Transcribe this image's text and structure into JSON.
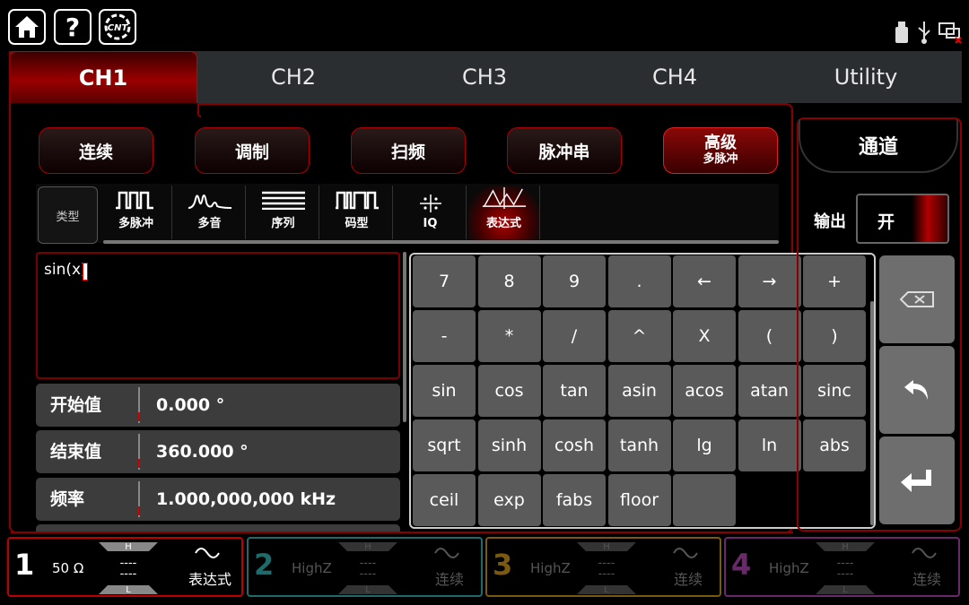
{
  "status_icons": [
    "usb-drive-icon",
    "usb-icon",
    "network-disconnected-icon"
  ],
  "tabs": [
    {
      "label": "CH1",
      "active": true
    },
    {
      "label": "CH2",
      "active": false
    },
    {
      "label": "CH3",
      "active": false
    },
    {
      "label": "CH4",
      "active": false
    },
    {
      "label": "Utility",
      "active": false
    }
  ],
  "modes": [
    {
      "label": "连续"
    },
    {
      "label": "调制"
    },
    {
      "label": "扫频"
    },
    {
      "label": "脉冲串"
    },
    {
      "label": "高级",
      "sub": "多脉冲",
      "active": true
    }
  ],
  "type_label": "类型",
  "types": [
    {
      "label": "多脉冲",
      "icon": "multi-pulse-icon"
    },
    {
      "label": "多音",
      "icon": "multi-tone-icon"
    },
    {
      "label": "序列",
      "icon": "sequence-icon"
    },
    {
      "label": "码型",
      "icon": "pattern-icon"
    },
    {
      "label": "IQ",
      "icon": "iq-icon"
    },
    {
      "label": "表达式",
      "icon": "expression-icon",
      "active": true
    }
  ],
  "expression": "sin(x)",
  "params": [
    {
      "label": "开始值",
      "value": "0.000 °"
    },
    {
      "label": "结束值",
      "value": "360.000 °"
    },
    {
      "label": "频率",
      "value": "1.000,000,000 kHz"
    }
  ],
  "keys": [
    [
      "7",
      "8",
      "9",
      ".",
      "←",
      "→",
      "+"
    ],
    [
      "-",
      "*",
      "/",
      "^",
      "X",
      "(",
      ")"
    ],
    [
      "sin",
      "cos",
      "tan",
      "asin",
      "acos",
      "atan",
      "sinc"
    ],
    [
      "sqrt",
      "sinh",
      "cosh",
      "tanh",
      "lg",
      "ln",
      "abs"
    ],
    [
      "ceil",
      "exp",
      "fabs",
      "floor",
      ""
    ]
  ],
  "side_panel": {
    "title": "通道",
    "output_label": "输出",
    "output_value": "开"
  },
  "channels": [
    {
      "num": "1",
      "impedance": "50 Ω",
      "h": "H",
      "l": "L",
      "level": "----",
      "mode": "表达式",
      "color": "#c00000",
      "active": true
    },
    {
      "num": "2",
      "impedance": "HighZ",
      "h": "H",
      "l": "L",
      "level": "----",
      "mode": "连续",
      "color": "#1f6b6b",
      "active": false
    },
    {
      "num": "3",
      "impedance": "HighZ",
      "h": "H",
      "l": "L",
      "level": "----",
      "mode": "连续",
      "color": "#7a5a10",
      "active": false
    },
    {
      "num": "4",
      "impedance": "HighZ",
      "h": "H",
      "l": "L",
      "level": "----",
      "mode": "连续",
      "color": "#6a2a6a",
      "active": false
    }
  ]
}
